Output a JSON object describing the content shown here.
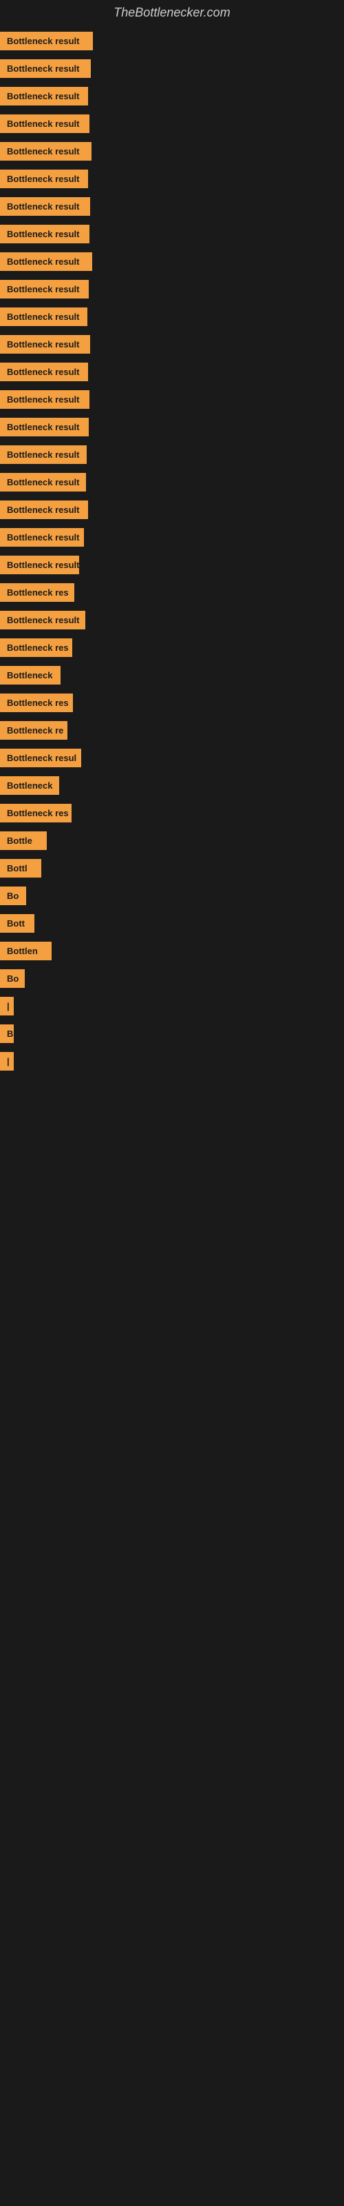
{
  "site": {
    "title": "TheBottlenecker.com"
  },
  "results": [
    {
      "label": "Bottleneck result",
      "width": 135
    },
    {
      "label": "Bottleneck result",
      "width": 132
    },
    {
      "label": "Bottleneck result",
      "width": 128
    },
    {
      "label": "Bottleneck result",
      "width": 130
    },
    {
      "label": "Bottleneck result",
      "width": 133
    },
    {
      "label": "Bottleneck result",
      "width": 128
    },
    {
      "label": "Bottleneck result",
      "width": 131
    },
    {
      "label": "Bottleneck result",
      "width": 130
    },
    {
      "label": "Bottleneck result",
      "width": 134
    },
    {
      "label": "Bottleneck result",
      "width": 129
    },
    {
      "label": "Bottleneck result",
      "width": 127
    },
    {
      "label": "Bottleneck result",
      "width": 131
    },
    {
      "label": "Bottleneck result",
      "width": 128
    },
    {
      "label": "Bottleneck result",
      "width": 130
    },
    {
      "label": "Bottleneck result",
      "width": 129
    },
    {
      "label": "Bottleneck result",
      "width": 126
    },
    {
      "label": "Bottleneck result",
      "width": 125
    },
    {
      "label": "Bottleneck result",
      "width": 128
    },
    {
      "label": "Bottleneck result",
      "width": 122
    },
    {
      "label": "Bottleneck result",
      "width": 115
    },
    {
      "label": "Bottleneck res",
      "width": 108
    },
    {
      "label": "Bottleneck result",
      "width": 124
    },
    {
      "label": "Bottleneck res",
      "width": 105
    },
    {
      "label": "Bottleneck",
      "width": 88
    },
    {
      "label": "Bottleneck res",
      "width": 106
    },
    {
      "label": "Bottleneck re",
      "width": 98
    },
    {
      "label": "Bottleneck resul",
      "width": 118
    },
    {
      "label": "Bottleneck",
      "width": 86
    },
    {
      "label": "Bottleneck res",
      "width": 104
    },
    {
      "label": "Bottle",
      "width": 68
    },
    {
      "label": "Bottl",
      "width": 60
    },
    {
      "label": "Bo",
      "width": 38
    },
    {
      "label": "Bott",
      "width": 50
    },
    {
      "label": "Bottlen",
      "width": 75
    },
    {
      "label": "Bo",
      "width": 36
    },
    {
      "label": "|",
      "width": 12
    },
    {
      "label": "B",
      "width": 16
    },
    {
      "label": "|",
      "width": 10
    },
    {
      "label": "",
      "width": 20
    },
    {
      "label": "",
      "width": 18
    },
    {
      "label": "",
      "width": 14
    }
  ]
}
